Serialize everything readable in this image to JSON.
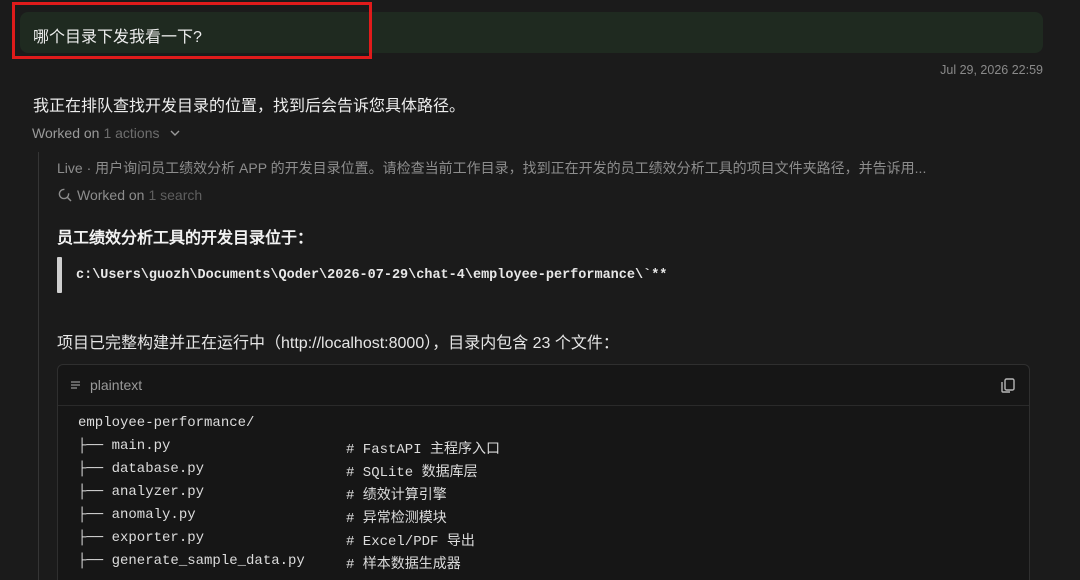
{
  "user_message": "哪个目录下发我看一下?",
  "timestamp": "Jul 29, 2026 22:59",
  "assistant_reply": "我正在排队查找开发目录的位置，找到后会告诉您具体路径。",
  "worked_on": {
    "label": "Worked on",
    "count": "1 actions"
  },
  "live_line": "Live · 用户询问员工绩效分析 APP 的开发目录位置。请检查当前工作目录，找到正在开发的员工绩效分析工具的项目文件夹路径，并告诉用...",
  "worked_search": {
    "label": "Worked on",
    "count": "1 search"
  },
  "heading": "员工绩效分析工具的开发目录位于：",
  "path_quote": "c:\\Users\\guozh\\Documents\\Qoder\\2026-07-29\\chat-4\\employee-performance\\`**",
  "description": "项目已完整构建并正在运行中（http://localhost:8000），目录内包含 23 个文件：",
  "code_block": {
    "language": "plaintext",
    "lines": [
      {
        "tree": "employee-performance/",
        "comment": ""
      },
      {
        "tree": "├── main.py",
        "comment": "# FastAPI 主程序入口"
      },
      {
        "tree": "├── database.py",
        "comment": "# SQLite 数据库层"
      },
      {
        "tree": "├── analyzer.py",
        "comment": "# 绩效计算引擎"
      },
      {
        "tree": "├── anomaly.py",
        "comment": "# 异常检测模块"
      },
      {
        "tree": "├── exporter.py",
        "comment": "# Excel/PDF 导出"
      },
      {
        "tree": "├── generate_sample_data.py",
        "comment": "# 样本数据生成器"
      }
    ]
  },
  "icons": {
    "chevron": "chevron-down-icon",
    "search": "search-icon",
    "lines": "lines-icon",
    "copy": "copy-icon"
  }
}
